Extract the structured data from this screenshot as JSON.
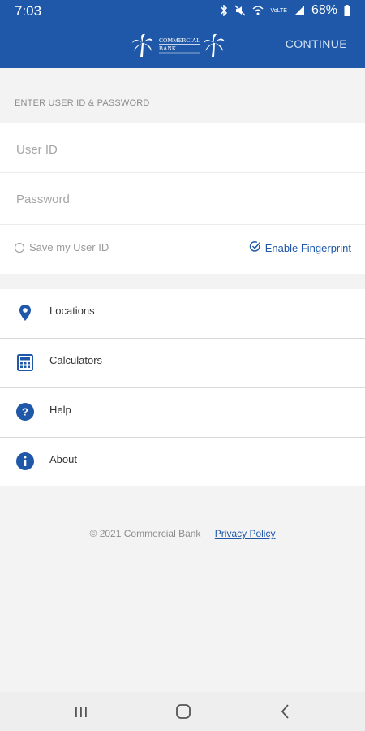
{
  "status_bar": {
    "time": "7:03",
    "battery": "68%",
    "network_label": "VoLTE"
  },
  "header": {
    "brand_line1": "COMMERCIAL",
    "brand_line2": "BANK",
    "continue_label": "CONTINUE"
  },
  "login": {
    "section_label": "ENTER USER ID & PASSWORD",
    "user_id_placeholder": "User ID",
    "password_placeholder": "Password",
    "save_user_label": "Save my User ID",
    "fingerprint_label": "Enable Fingerprint"
  },
  "menu": {
    "items": [
      {
        "label": "Locations",
        "icon": "location-pin-icon"
      },
      {
        "label": "Calculators",
        "icon": "calculator-icon"
      },
      {
        "label": "Help",
        "icon": "help-circle-icon"
      },
      {
        "label": "About",
        "icon": "info-circle-icon"
      }
    ]
  },
  "footer": {
    "copyright": "© 2021 Commercial Bank",
    "privacy_link": "Privacy Policy"
  },
  "colors": {
    "brand_blue": "#1f58a8",
    "background": "#f3f3f3"
  }
}
